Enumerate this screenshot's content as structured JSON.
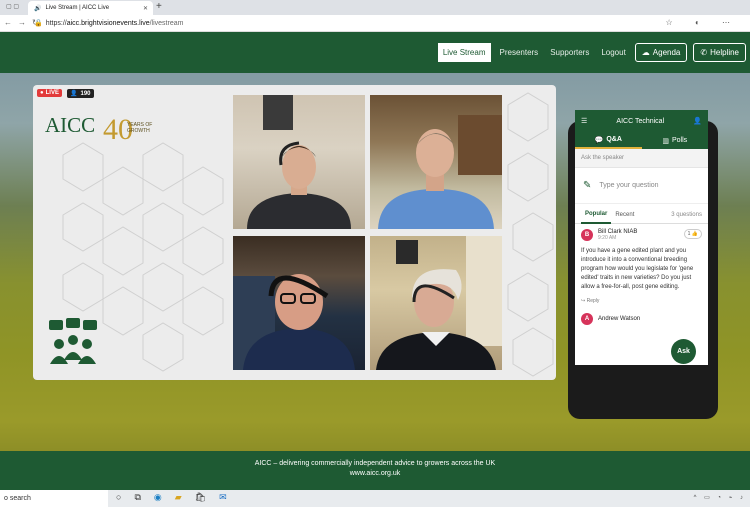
{
  "browser": {
    "tab_title": "Live Stream | AICC Live",
    "url_host": "aicc.brightvisionevents.live",
    "url_scheme": "https://",
    "url_path": "/livestream"
  },
  "nav": {
    "items": [
      "Live Stream",
      "Presenters",
      "Supporters",
      "Logout"
    ],
    "agenda_label": "Agenda",
    "helpline_label": "Helpline"
  },
  "player": {
    "live_label": "LIVE",
    "viewer_count": "190",
    "logo_text": "AICC",
    "logo_number": "40",
    "logo_sub": "YEARS OF",
    "logo_sub2": "GROWTH"
  },
  "phone": {
    "title": "AICC Technical",
    "tab_qa": "Q&A",
    "tab_polls": "Polls",
    "ask_label": "Ask the speaker",
    "input_placeholder": "Type your question",
    "filter_popular": "Popular",
    "filter_recent": "Recent",
    "question_count": "3 questions",
    "questions": [
      {
        "initial": "B",
        "name": "Bill Clark NIAB",
        "time": "9:20 AM",
        "likes": "1",
        "text": "If you have a gene edited plant and you introduce it into a conventional breeding program how would you legislate for 'gene edited' traits in new varieties? Do you just allow a free-for-all, post gene editing.",
        "reply": "Reply"
      },
      {
        "initial": "A",
        "name": "Andrew Watson"
      }
    ],
    "ask_button": "Ask"
  },
  "footer": {
    "line1": "AICC – delivering commercially independent advice to growers across the UK",
    "line2": "www.aicc.org.uk"
  },
  "taskbar": {
    "search": "o search"
  },
  "colors": {
    "brand_green": "#1e5a33",
    "live_red": "#e23b3b",
    "gold": "#c39a30"
  }
}
